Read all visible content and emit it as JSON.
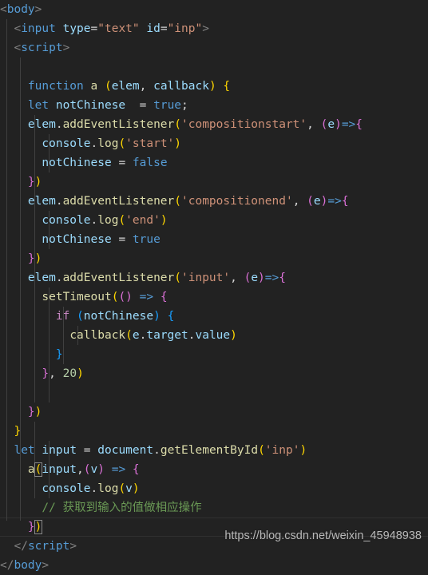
{
  "editor": {
    "background": "#222222",
    "line_height": 24,
    "font_size": 14.5,
    "indent_guide_color": "#404040",
    "current_line_border_color": "#303030",
    "bracket_match_border_color": "#888888"
  },
  "theme": {
    "tag_bracket": "#808080",
    "tag_name": "#569cd6",
    "attribute": "#9cdcfe",
    "string": "#ce9178",
    "keyword": "#569cd6",
    "control_keyword": "#c586c0",
    "function_name": "#dcdcaa",
    "variable": "#9cdcfe",
    "operator": "#d4d4d4",
    "number": "#b5cea8",
    "comment": "#6a9955",
    "bracket_yellow": "#ffd700",
    "bracket_purple": "#da70d6",
    "bracket_blue": "#179fff"
  },
  "code": {
    "language": "html-javascript",
    "lines": [
      "<body>",
      "  <input type=\"text\" id=\"inp\">",
      "  <script>",
      "",
      "    function a (elem, callback) {",
      "    let notChinese  = true;",
      "    elem.addEventListener('compositionstart', (e)=>{",
      "      console.log('start')",
      "      notChinese = false",
      "    })",
      "    elem.addEventListener('compositionend', (e)=>{",
      "      console.log('end')",
      "      notChinese = true",
      "    })",
      "    elem.addEventListener('input', (e)=>{",
      "      setTimeout(() => {",
      "        if (notChinese) {",
      "          callback(e.target.value)",
      "        }",
      "      }, 20)",
      "",
      "    })",
      "  }",
      "  let input = document.getElementById('inp')",
      "    a(input,(v) => {",
      "      console.log(v)",
      "      // 获取到输入的值做相应操作",
      "    })",
      "  </script>",
      "</body>"
    ],
    "comment_text": "// 获取到输入的值做相应操作",
    "timeout_delay": "20",
    "element_id": "inp",
    "input_type": "text",
    "flag_variable": "notChinese",
    "events": [
      "compositionstart",
      "compositionend",
      "input"
    ],
    "log_messages": [
      "start",
      "end"
    ]
  },
  "watermark": {
    "text": "https://blog.csdn.net/weixin_45948938"
  }
}
